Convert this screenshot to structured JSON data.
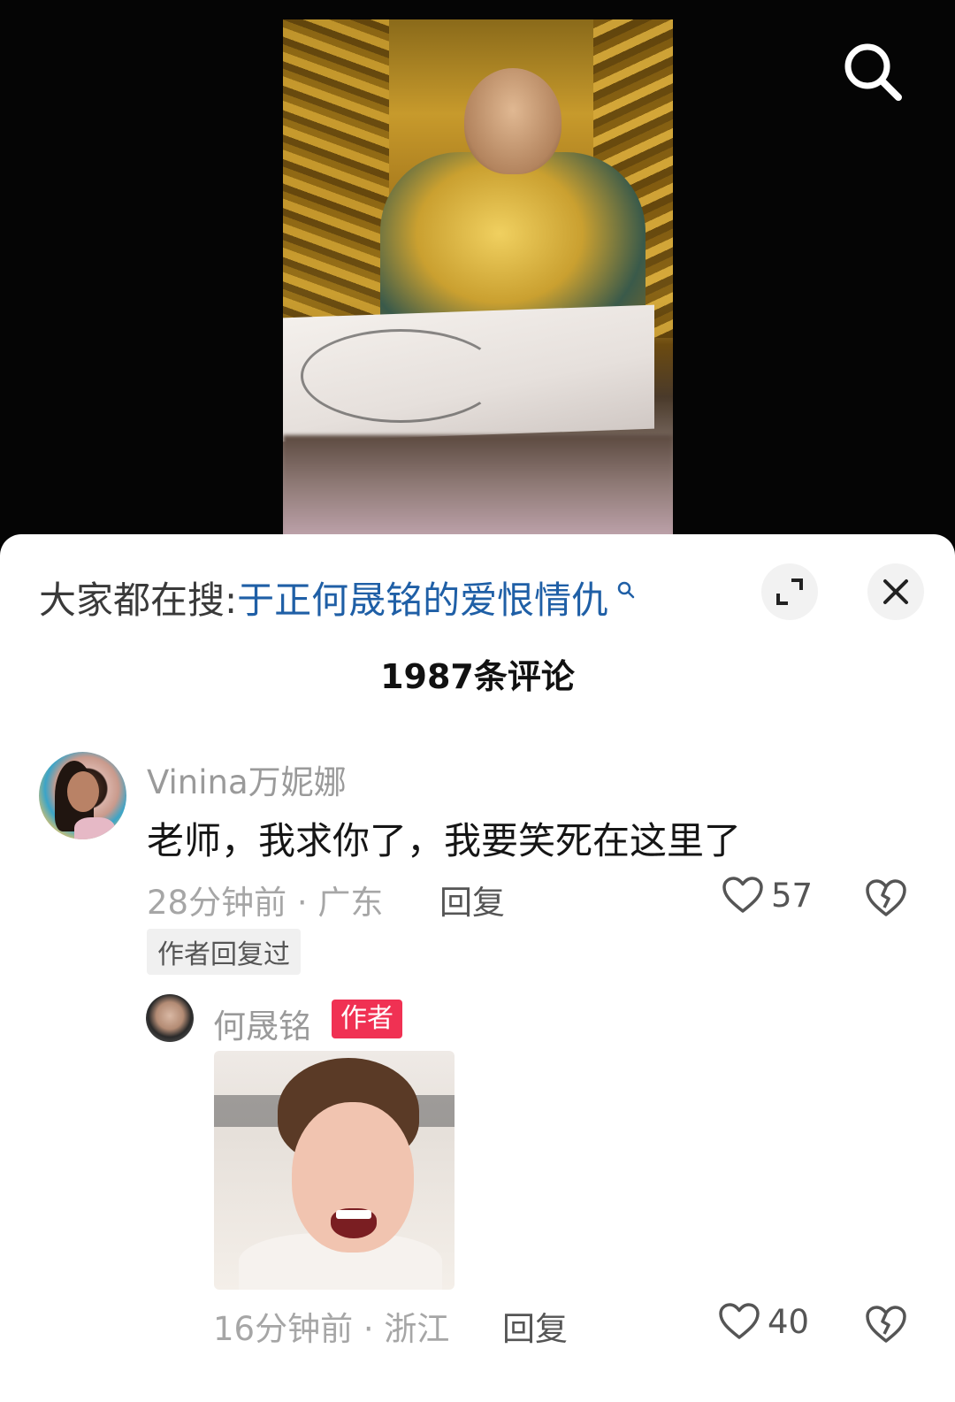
{
  "video": {
    "search_icon": "search-icon"
  },
  "sheet": {
    "suggest_prefix": "大家都在搜",
    "suggest_colon": ":",
    "suggest_term": "于正何晟铭的爱恨情仇",
    "expand_icon": "expand-icon",
    "close_icon": "close-icon",
    "comment_count": "1987条评论"
  },
  "comments": [
    {
      "user": "Vinina万妮娜",
      "text": "老师，我求你了，我要笑死在这里了",
      "meta": "28分钟前 · 广东",
      "reply_label": "回复",
      "likes": "57",
      "author_replied": "作者回复过"
    }
  ],
  "reply": {
    "user": "何晟铭",
    "author_badge": "作者",
    "meta": "16分钟前 · 浙江",
    "reply_label": "回复",
    "likes": "40"
  }
}
